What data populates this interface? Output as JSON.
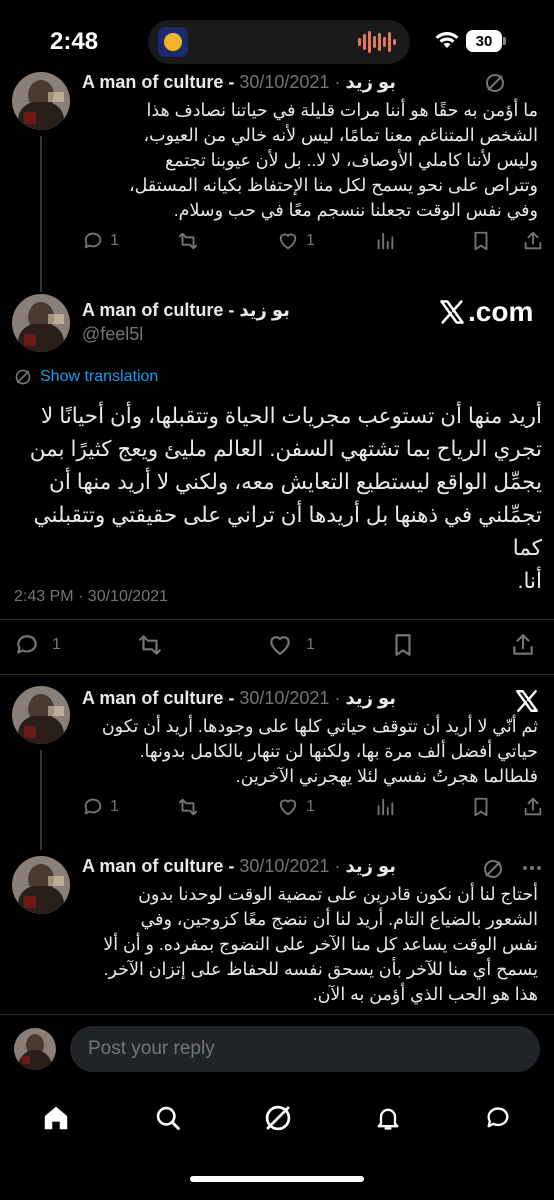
{
  "status": {
    "time": "2:48",
    "battery": "30"
  },
  "tweet1": {
    "name": "A man of culture - بو زيد",
    "date": "· 30/10/2021",
    "lines": [
      "ما أؤمن به حقًا هو أننا مرات قليلة في حياتنا  نصادف هذا",
      "الشخص المتناغم معنا تمامًا، ليس لأنه خالي من العيوب،",
      "وليس لأننا كاملي الأوصاف، لا لا.. بل لأن عيوبنا تجتمع",
      "وتتراص على نحو يسمح لكل منا الإحتفاظ بكيانه المستقل،",
      "وفي نفس الوقت تجعلنا ننسجم معًا في حب وسلام."
    ],
    "replies": "1",
    "likes": "1"
  },
  "main": {
    "name": "A man of culture - بو زيد",
    "handle": "@feel5l",
    "source": ".com",
    "show_translation": "Show translation",
    "lines": [
      "أريد منها أن تستوعب مجريات الحياة وتتقبلها، وأن أحيانًا لا",
      "تجري الرياح بما تشتهي السفن. العالم مليئ ويعج كثيرًا بمن",
      "يجمِّل الواقع ليستطيع التعايش معه، ولكني لا أريد منها أن",
      "تجمِّلني في ذهنها بل أريدها أن تراني على حقيقتي وتتقبلني كما",
      "أنا."
    ],
    "timestamp": "2:43 PM · 30/10/2021",
    "replies": "1",
    "likes": "1"
  },
  "tweet3": {
    "name": "A man of culture - بو زيد",
    "date": "· 30/10/2021",
    "lines": [
      "ثم أنّي لا أريد أن تتوقف حياتي كلها على وجودها. أريد أن تكون",
      "حياتي أفضل ألف مرة بها، ولكنها لن تنهار بالكامل بدونها.",
      "فلطالما هجرتُ نفسي لئلا يهجرني الآخرين."
    ],
    "replies": "1",
    "likes": "1"
  },
  "tweet4": {
    "name": "A man of culture - بو زيد",
    "date": "· 30/10/2021",
    "lines": [
      "أحتاج لنا أن نكون قادرين على تمضية الوقت لوحدنا بدون",
      "الشعور بالضياع التام. أريد لنا أن ننضج معًا كزوجين، وفي",
      "نفس الوقت يساعد كل منا الآخر على النضوج بمفرده. و أن ألا",
      "يسمح أي منا للآخر بأن يسحق نفسه للحفاظ على إتزان الآخر.",
      "هذا هو الحب الذي أؤمن به الآن."
    ]
  },
  "reply_bar": {
    "placeholder": "Post your reply"
  },
  "icons": {
    "reply": "comment-icon",
    "repost": "repost-icon",
    "like": "heart-icon",
    "views": "views-icon",
    "bookmark": "bookmark-icon",
    "share": "share-icon",
    "grok": "grok-icon",
    "x": "x-logo-icon"
  },
  "colors": {
    "accent": "#1d9bf0",
    "muted": "#71767b",
    "text": "#e7e9ea",
    "background": "#000000"
  }
}
